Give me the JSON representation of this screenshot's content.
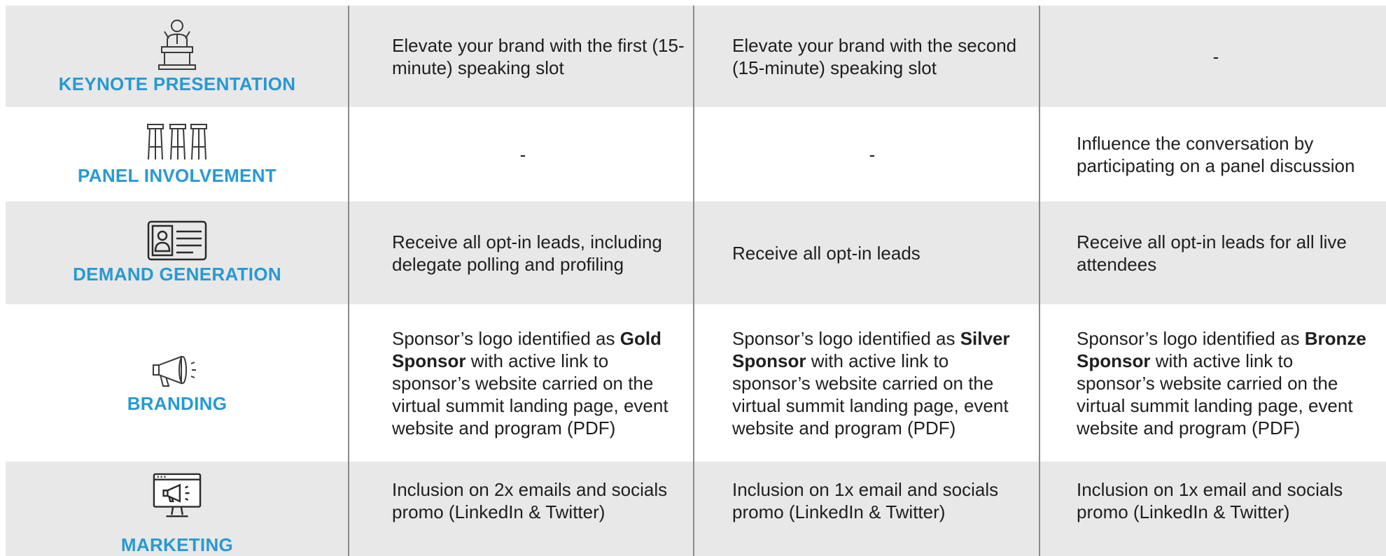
{
  "rows": [
    {
      "category": "KEYNOTE PRESENTATION",
      "icon": "podium-speaker-icon",
      "gold": "Elevate your brand with the first (15-minute) speaking slot",
      "silver": "Elevate your brand with the second (15-minute) speaking slot",
      "bronze": "-"
    },
    {
      "category": "PANEL INVOLVEMENT",
      "icon": "panel-stools-icon",
      "gold": "-",
      "silver": "-",
      "bronze": "Influence the conversation by participating on a panel discussion"
    },
    {
      "category": "DEMAND GENERATION",
      "icon": "id-card-icon",
      "gold": "Receive all opt-in leads, including delegate polling and profiling",
      "silver": "Receive all opt-in leads",
      "bronze": "Receive all opt-in leads for all live attendees"
    },
    {
      "category": "BRANDING",
      "icon": "megaphone-icon",
      "gold_pre": "Sponsor’s logo identified as",
      "gold_bold": "Gold Sponsor",
      "gold_post": "with active link to sponsor’s website carried on the virtual summit landing page, event website and program (PDF)",
      "silver_pre": "Sponsor’s logo identified as",
      "silver_bold": "Silver Sponsor",
      "silver_post": "with active link to sponsor’s website carried on the virtual summit landing page, event website and program (PDF)",
      "bronze_pre": "Sponsor’s logo identified as",
      "bronze_bold": "Bronze Sponsor",
      "bronze_post": "with active link to sponsor’s website carried on the virtual summit landing page, event website and program (PDF)"
    },
    {
      "category": "MARKETING",
      "icon": "monitor-megaphone-icon",
      "gold": "Inclusion on 2x emails and socials promo (LinkedIn & Twitter)",
      "silver": "Inclusion on 1x email and socials promo (LinkedIn & Twitter)",
      "bronze": "Inclusion on 1x email and socials promo (LinkedIn & Twitter)"
    }
  ],
  "colors": {
    "accent": "#2799d4",
    "row_gray": "#e8e8e8",
    "divider": "#8a8a8a",
    "text": "#1f1f1f"
  }
}
